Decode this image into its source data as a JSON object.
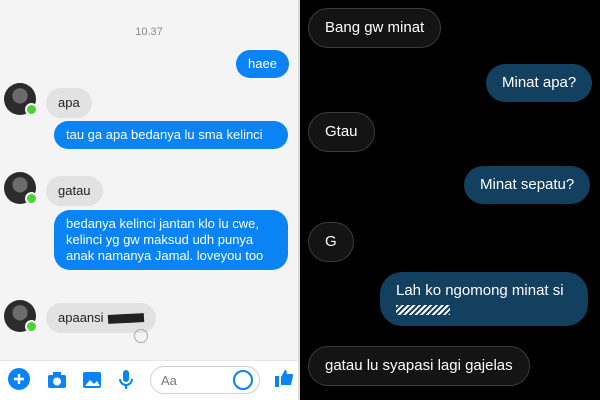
{
  "left": {
    "time": "10.37",
    "messages": [
      {
        "side": "out",
        "text": "haee"
      },
      {
        "side": "in",
        "text": "apa"
      },
      {
        "side": "out",
        "text": "tau ga apa bedanya lu sma kelinci"
      },
      {
        "side": "in",
        "text": "gatau"
      },
      {
        "side": "out",
        "text": "bedanya kelinci jantan klo lu cwe, kelinci yg gw maksud udh punya anak namanya Jamal.  loveyou too"
      },
      {
        "side": "in",
        "text": "apaansi"
      }
    ],
    "input_placeholder": "Aa",
    "toolbar_icons": [
      "plus-icon",
      "camera-icon",
      "image-icon",
      "microphone-icon",
      "emoji-icon",
      "thumbs-up-icon"
    ],
    "accent": "#0a83f4",
    "online_color": "#4cd137"
  },
  "right": {
    "messages": [
      {
        "side": "in",
        "text": "Bang gw minat"
      },
      {
        "side": "out",
        "text": "Minat apa?"
      },
      {
        "side": "in",
        "text": "Gtau"
      },
      {
        "side": "out",
        "text": "Minat sepatu?"
      },
      {
        "side": "in",
        "text": "G"
      },
      {
        "side": "out",
        "text": "Lah ko ngomong minat si"
      },
      {
        "side": "in",
        "text": "gatau lu syapasi lagi gajelas"
      }
    ],
    "bubble_out_color": "#13405f"
  }
}
